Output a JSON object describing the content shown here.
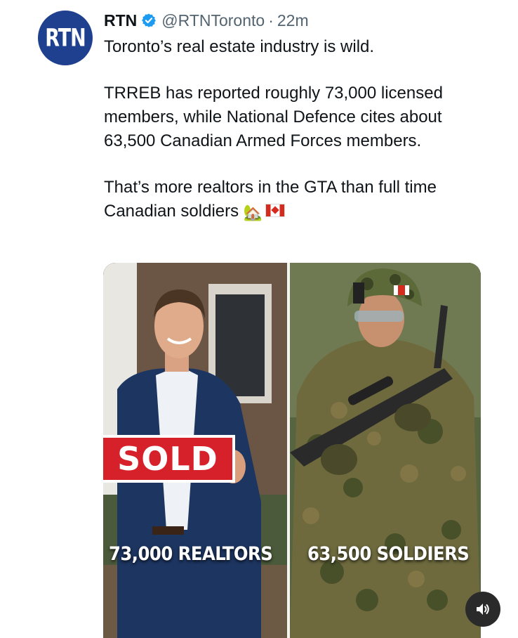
{
  "avatar": {
    "text": "RTN"
  },
  "author": {
    "name": "RTN",
    "handle": "@RTNToronto",
    "separator": "·",
    "time": "22m"
  },
  "tweet": {
    "paragraphs": [
      "Toronto’s real estate industry is wild.",
      "TRREB has reported roughly 73,000 licensed members, while National Defence cites about 63,500 Canadian Armed Forces members.",
      "That’s more realtors in the GTA than full time Canadian soldiers"
    ],
    "emoji_house": "🏡",
    "flag_icon": "canada-flag"
  },
  "media": {
    "left_caption": "73,000 REALTORS",
    "right_caption": "63,500 SOLDIERS",
    "sign_text": "SOLD"
  },
  "colors": {
    "avatar_bg": "#1f3f8f",
    "verified_blue": "#1d9bf0",
    "sold_red": "#d6202a",
    "text_secondary": "#536471"
  },
  "icons": {
    "verified": "verified-badge-icon",
    "sound": "speaker-icon"
  }
}
